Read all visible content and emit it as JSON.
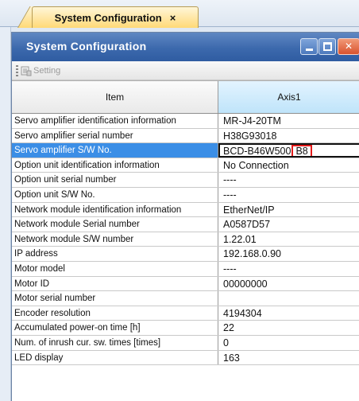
{
  "doc_tab": {
    "label": "System Configuration",
    "close_glyph": "×"
  },
  "window": {
    "title": "System Configuration",
    "controls": {
      "minimize": "minimize-icon",
      "maximize": "maximize-icon",
      "close": "close-icon",
      "close_glyph": "✕"
    }
  },
  "toolbar": {
    "setting_label": "Setting",
    "setting_icon": "setting-icon"
  },
  "table": {
    "headers": {
      "item": "Item",
      "axis": "Axis1"
    },
    "rows": [
      {
        "item": "Servo amplifier identification information",
        "value": "MR-J4-20TM"
      },
      {
        "item": "Servo amplifier serial number",
        "value": "H38G93018"
      },
      {
        "item": "Servo amplifier S/W No.",
        "value": "BCD-B46W500",
        "value_suffix": "B8",
        "selected": true
      },
      {
        "item": "Option unit identification information",
        "value": "No Connection"
      },
      {
        "item": "Option unit serial number",
        "value": "----"
      },
      {
        "item": "Option unit S/W No.",
        "value": "----"
      },
      {
        "item": "Network module identification information",
        "value": "EtherNet/IP"
      },
      {
        "item": "Network module Serial number",
        "value": "A0587D57"
      },
      {
        "item": "Network module S/W number",
        "value": "1.22.01"
      },
      {
        "item": "IP address",
        "value": "192.168.0.90"
      },
      {
        "item": "Motor model",
        "value": "----"
      },
      {
        "item": "Motor ID",
        "value": "00000000"
      },
      {
        "item": "Motor serial number",
        "value": ""
      },
      {
        "item": "Encoder resolution",
        "value": "4194304"
      },
      {
        "item": "Accumulated power-on time [h]",
        "value": "22"
      },
      {
        "item": "Num. of inrush cur. sw. times [times]",
        "value": "0"
      },
      {
        "item": "LED display",
        "value": "163"
      }
    ]
  },
  "colors": {
    "titlebar": "#3c69ad",
    "selection": "#3b8ee6",
    "highlight_box": "#e31a1a",
    "doc_tab": "#ffd977"
  }
}
